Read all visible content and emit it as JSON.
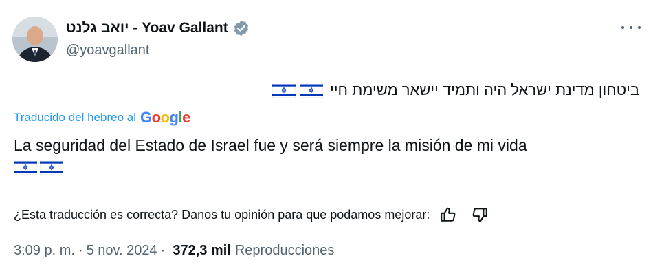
{
  "author": {
    "display_name": "יואב גלנט - Yoav Gallant",
    "handle": "@yoavgallant",
    "verified_color": "#829aab"
  },
  "tweet": {
    "original_text": "ביטחון מדינת ישראל היה ותמיד יישאר משימת חיי",
    "translated_label": "Traducido del hebreo al",
    "translation_provider": "Google",
    "translated_text": "La seguridad del Estado de Israel fue y será siempre la misión de mi vida"
  },
  "feedback": {
    "prompt": "¿Esta traducción es correcta? Danos tu opinión para que podamos mejorar:"
  },
  "meta": {
    "time": "3:09 p. m.",
    "separator": "·",
    "date": "5 nov. 2024",
    "views_count": "372,3 mil",
    "views_label": "Reproducciones"
  },
  "icons": {
    "avatar": "avatar-photo",
    "verified": "verified-badge-icon",
    "more": "more-options-icon",
    "flag": "israel-flag-icon",
    "like": "thumbs-up-icon",
    "dislike": "thumbs-down-icon"
  },
  "colors": {
    "text": "#0f1419",
    "secondary": "#536471",
    "link": "#1d9bf0",
    "flag_blue": "#0038b8"
  }
}
